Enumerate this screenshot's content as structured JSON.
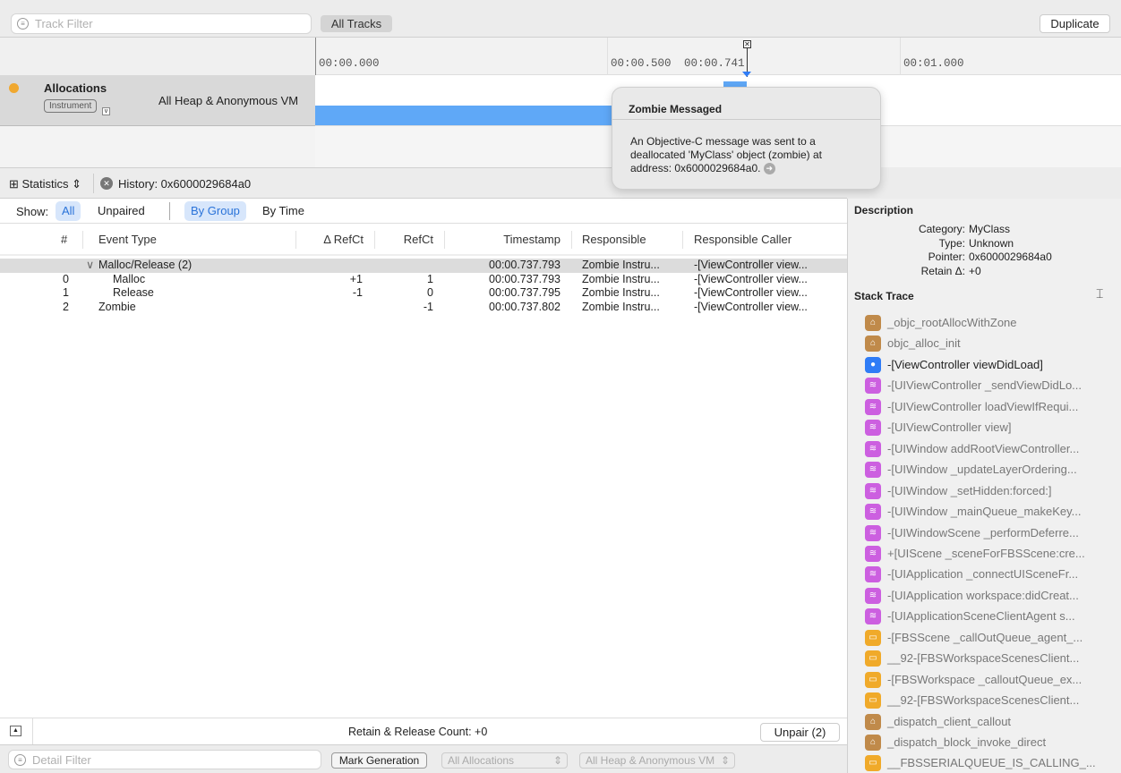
{
  "toolbar": {
    "track_filter_placeholder": "Track Filter",
    "all_tracks": "All Tracks",
    "duplicate": "Duplicate"
  },
  "timeline": {
    "ticks": [
      "00:00.000",
      "00:00.500",
      "00:00.741",
      "00:01.000"
    ]
  },
  "track": {
    "name": "Allocations",
    "instrument_badge": "Instrument",
    "detail": "All Heap & Anonymous VM",
    "color": "#5fa8f7"
  },
  "tooltip": {
    "title": "Zombie Messaged",
    "body": "An Objective-C message was sent to a deallocated 'MyClass' object (zombie) at address: 0x6000029684a0."
  },
  "statbar": {
    "view": "Statistics",
    "history": "History: 0x6000029684a0"
  },
  "show": {
    "label": "Show:",
    "all": "All",
    "unpaired": "Unpaired",
    "by_group": "By Group",
    "by_time": "By Time"
  },
  "table": {
    "columns": [
      "#",
      "Event Type",
      "Δ RefCt",
      "RefCt",
      "Timestamp",
      "Responsible",
      "Responsible Caller"
    ],
    "rows": [
      {
        "num": "",
        "type": "Malloc/Release (2)",
        "delta": "",
        "refct": "",
        "ts": "00:00.737.793",
        "resp": "Zombie Instru...",
        "caller": "-[ViewController view..."
      },
      {
        "num": "0",
        "type": "Malloc",
        "delta": "+1",
        "refct": "1",
        "ts": "00:00.737.793",
        "resp": "Zombie Instru...",
        "caller": "-[ViewController view..."
      },
      {
        "num": "1",
        "type": "Release",
        "delta": "-1",
        "refct": "0",
        "ts": "00:00.737.795",
        "resp": "Zombie Instru...",
        "caller": "-[ViewController view..."
      },
      {
        "num": "2",
        "type": "Zombie",
        "delta": "",
        "refct": "-1",
        "ts": "00:00.737.802",
        "resp": "Zombie Instru...",
        "caller": "-[ViewController view..."
      }
    ]
  },
  "description": {
    "title": "Description",
    "fields": [
      {
        "k": "Category:",
        "v": "MyClass"
      },
      {
        "k": "Type:",
        "v": "Unknown"
      },
      {
        "k": "Pointer:",
        "v": "0x6000029684a0"
      },
      {
        "k": "Retain Δ:",
        "v": "+0"
      }
    ]
  },
  "stack": {
    "title": "Stack Trace",
    "frames": [
      {
        "t": "_objc_rootAllocWithZone",
        "k": "lib"
      },
      {
        "t": "objc_alloc_init",
        "k": "lib"
      },
      {
        "t": "-[ViewController viewDidLoad]",
        "k": "user"
      },
      {
        "t": "-[UIViewController _sendViewDidLo...",
        "k": "fw"
      },
      {
        "t": "-[UIViewController loadViewIfRequi...",
        "k": "fw"
      },
      {
        "t": "-[UIViewController view]",
        "k": "fw"
      },
      {
        "t": "-[UIWindow addRootViewController...",
        "k": "fw"
      },
      {
        "t": "-[UIWindow _updateLayerOrdering...",
        "k": "fw"
      },
      {
        "t": "-[UIWindow _setHidden:forced:]",
        "k": "fw"
      },
      {
        "t": "-[UIWindow _mainQueue_makeKey...",
        "k": "fw"
      },
      {
        "t": "-[UIWindowScene _performDeferre...",
        "k": "fw"
      },
      {
        "t": "+[UIScene _sceneForFBSScene:cre...",
        "k": "fw"
      },
      {
        "t": "-[UIApplication _connectUISceneFr...",
        "k": "fw"
      },
      {
        "t": "-[UIApplication workspace:didCreat...",
        "k": "fw"
      },
      {
        "t": "-[UIApplicationSceneClientAgent s...",
        "k": "fw"
      },
      {
        "t": "-[FBSScene _callOutQueue_agent_...",
        "k": "fbs"
      },
      {
        "t": "__92-[FBSWorkspaceScenesClient...",
        "k": "fbs"
      },
      {
        "t": "-[FBSWorkspace _calloutQueue_ex...",
        "k": "fbs"
      },
      {
        "t": "__92-[FBSWorkspaceScenesClient...",
        "k": "fbs"
      },
      {
        "t": "_dispatch_client_callout",
        "k": "lib"
      },
      {
        "t": "_dispatch_block_invoke_direct",
        "k": "lib"
      },
      {
        "t": "__FBSSERIALQUEUE_IS_CALLING_...",
        "k": "fbs"
      }
    ]
  },
  "bottom": {
    "count": "Retain & Release Count: +0",
    "unpair": "Unpair (2)"
  },
  "filterbar": {
    "detail_filter_placeholder": "Detail Filter",
    "mark_generation": "Mark Generation",
    "allocations": "All Allocations",
    "heap": "All Heap & Anonymous VM"
  },
  "colors": {
    "lib": "#c08a4a",
    "user": "#2f7cf6",
    "fw": "#cc5fe0",
    "fbs": "#f0aa2a",
    "accent": "#2a73d9"
  }
}
